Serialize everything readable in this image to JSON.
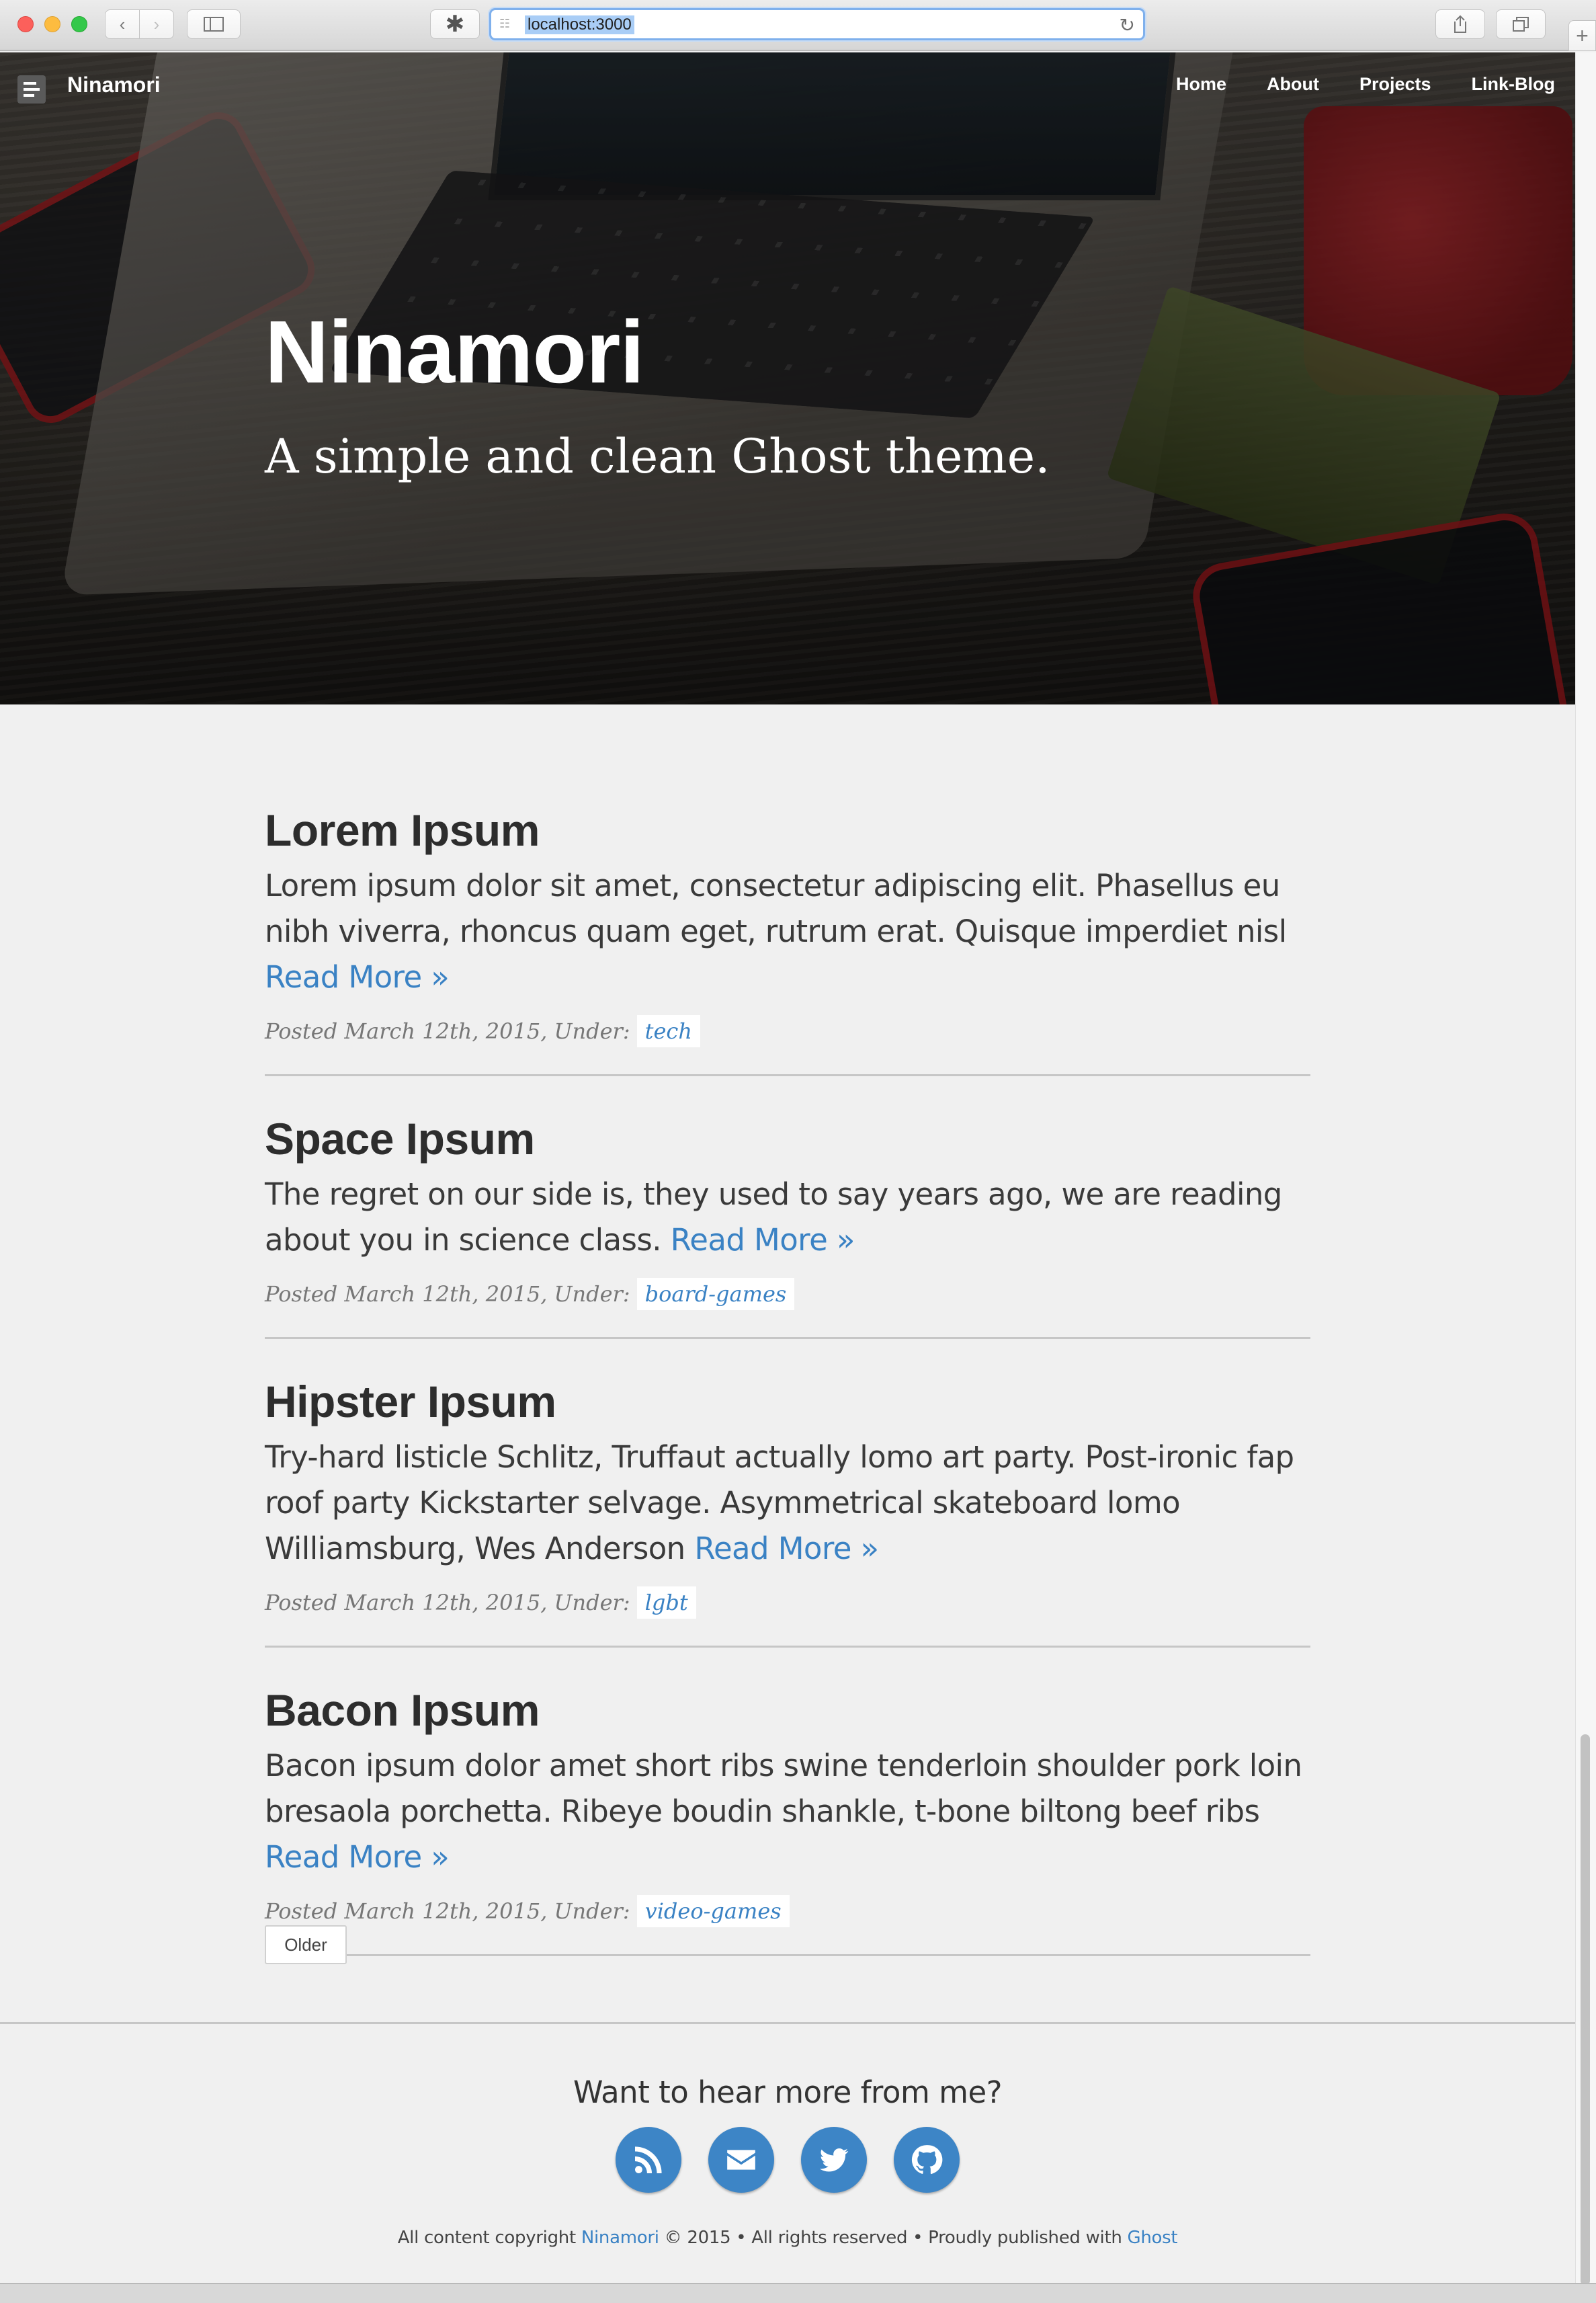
{
  "browser": {
    "url": "localhost:3000",
    "icons": [
      "back-icon",
      "forward-icon",
      "sidebar-icon",
      "extension-icon",
      "reload-icon",
      "share-icon",
      "tabs-icon",
      "new-tab-icon"
    ]
  },
  "site": {
    "brand": "Ninamori",
    "nav": [
      "Home",
      "About",
      "Projects",
      "Link-Blog"
    ],
    "hero_title": "Ninamori",
    "hero_tagline": "A simple and clean Ghost theme."
  },
  "posts": [
    {
      "title": "Lorem Ipsum",
      "excerpt": "Lorem ipsum dolor sit amet, consectetur adipiscing elit. Phasellus eu nibh viverra, rhoncus quam eget, rutrum erat. Quisque imperdiet nisl",
      "read_more": "Read More »",
      "meta": "Posted March 12th, 2015, Under:",
      "tag": "tech"
    },
    {
      "title": "Space Ipsum",
      "excerpt": "The regret on our side is, they used to say years ago, we are reading about you in science class.",
      "read_more": "Read More »",
      "meta": "Posted March 12th, 2015, Under:",
      "tag": "board-games"
    },
    {
      "title": "Hipster Ipsum",
      "excerpt": "Try-hard listicle Schlitz, Truffaut actually lomo art party. Post-ironic fap roof party Kickstarter selvage. Asymmetrical skateboard lomo Williamsburg, Wes Anderson",
      "read_more": "Read More »",
      "meta": "Posted March 12th, 2015, Under:",
      "tag": "lgbt"
    },
    {
      "title": "Bacon Ipsum",
      "excerpt": "Bacon ipsum dolor amet short ribs swine tenderloin shoulder pork loin bresaola porchetta. Ribeye boudin shankle, t-bone biltong beef ribs",
      "read_more": "Read More »",
      "meta": "Posted March 12th, 2015, Under:",
      "tag": "video-games"
    }
  ],
  "pagination": {
    "older": "Older"
  },
  "footer": {
    "cta": "Want to hear more from me?",
    "social": [
      "rss-icon",
      "email-icon",
      "twitter-icon",
      "github-icon"
    ],
    "copyright_prefix": "All content copyright",
    "copyright_link": "Ninamori",
    "copyright_middle": "© 2015 • All rights reserved • Proudly published with",
    "ghost_link": "Ghost"
  },
  "colors": {
    "link": "#3a82c4",
    "social_bg": "#3d85c6",
    "page_bg": "#f0f0f0"
  }
}
